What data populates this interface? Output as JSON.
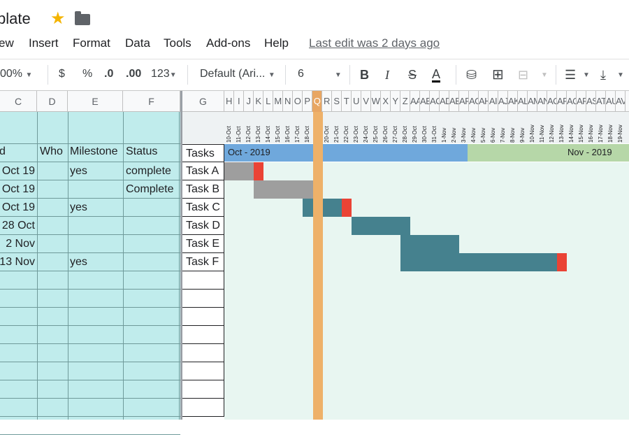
{
  "doc": {
    "title": "plate"
  },
  "menu": [
    "ew",
    "Insert",
    "Format",
    "Data",
    "Tools",
    "Add-ons",
    "Help"
  ],
  "last_edit": "Last edit was 2 days ago",
  "toolbar": {
    "zoom": "00%",
    "currency": "$",
    "percent": "%",
    "dec_less": ".0",
    "dec_more": ".00",
    "more_formats": "123",
    "font": "Default (Ari...",
    "size": "6"
  },
  "columns": {
    "left": [
      "C",
      "D",
      "E",
      "F"
    ],
    "g": "G",
    "gantt": [
      "H",
      "I",
      "J",
      "K",
      "L",
      "M",
      "N",
      "O",
      "P",
      "Q",
      "R",
      "S",
      "T",
      "U",
      "V",
      "W",
      "X",
      "Y",
      "Z",
      "AA",
      "AB",
      "AC",
      "AD",
      "AE",
      "AF",
      "AG",
      "AH",
      "AI",
      "AJ",
      "AK",
      "AL",
      "AM",
      "AN",
      "AO",
      "AP",
      "AQ",
      "AR",
      "AS",
      "AT",
      "AU",
      "AV"
    ]
  },
  "dates": [
    "10-Oct",
    "11-Oct",
    "12-Oct",
    "13-Oct",
    "14-Oct",
    "15-Oct",
    "16-Oct",
    "17-Oct",
    "18-Oct",
    "19-Oct",
    "20-Oct",
    "21-Oct",
    "22-Oct",
    "23-Oct",
    "24-Oct",
    "25-Oct",
    "26-Oct",
    "27-Oct",
    "28-Oct",
    "29-Oct",
    "30-Oct",
    "31-Oct",
    "1-Nov",
    "2-Nov",
    "3-Nov",
    "4-Nov",
    "5-Nov",
    "6-Nov",
    "7-Nov",
    "8-Nov",
    "9-Nov",
    "10-Nov",
    "11-Nov",
    "12-Nov",
    "13-Nov",
    "14-Nov",
    "15-Nov",
    "16-Nov",
    "17-Nov",
    "18-Nov",
    "19-Nov"
  ],
  "headers": {
    "c": "d",
    "who": "Who",
    "milestone": "Milestone",
    "status": "Status",
    "tasks": "Tasks"
  },
  "months": {
    "oct": "Oct - 2019",
    "nov": "Nov - 2019"
  },
  "rows": [
    {
      "end": "Oct 19",
      "who": "",
      "milestone": "yes",
      "status": "complete",
      "task": "Task A"
    },
    {
      "end": "Oct 19",
      "who": "",
      "milestone": "",
      "status": "Complete",
      "task": "Task B"
    },
    {
      "end": "Oct 19",
      "who": "",
      "milestone": "yes",
      "status": "",
      "task": "Task C"
    },
    {
      "end": "28 Oct",
      "who": "",
      "milestone": "",
      "status": "",
      "task": "Task D"
    },
    {
      "end": "2 Nov",
      "who": "",
      "milestone": "",
      "status": "",
      "task": "Task E"
    },
    {
      "end": "13 Nov",
      "who": "",
      "milestone": "yes",
      "status": "",
      "task": "Task F"
    }
  ],
  "colors": {
    "complete": "#9e9e9e",
    "active": "#45818e",
    "milestone": "#ea4335",
    "today": "#eeb169",
    "oct": "#6fa8dc",
    "nov": "#b6d7a8",
    "grid": "#c0ecec"
  },
  "today_date": "19-Oct",
  "tasks_gantt": [
    {
      "task": "Task A",
      "start": "10-Oct",
      "end": "12-Oct",
      "state": "complete",
      "milestone": "13-Oct"
    },
    {
      "task": "Task B",
      "start": "13-Oct",
      "end": "19-Oct",
      "state": "complete",
      "milestone": ""
    },
    {
      "task": "Task C",
      "start": "18-Oct",
      "end": "21-Oct",
      "state": "active",
      "milestone": "22-Oct"
    },
    {
      "task": "Task D",
      "start": "23-Oct",
      "end": "28-Oct",
      "state": "active",
      "milestone": ""
    },
    {
      "task": "Task E",
      "start": "28-Oct",
      "end": "2-Nov",
      "state": "active",
      "milestone": ""
    },
    {
      "task": "Task F",
      "start": "28-Oct",
      "end": "12-Nov",
      "state": "active",
      "milestone": "13-Nov"
    }
  ]
}
